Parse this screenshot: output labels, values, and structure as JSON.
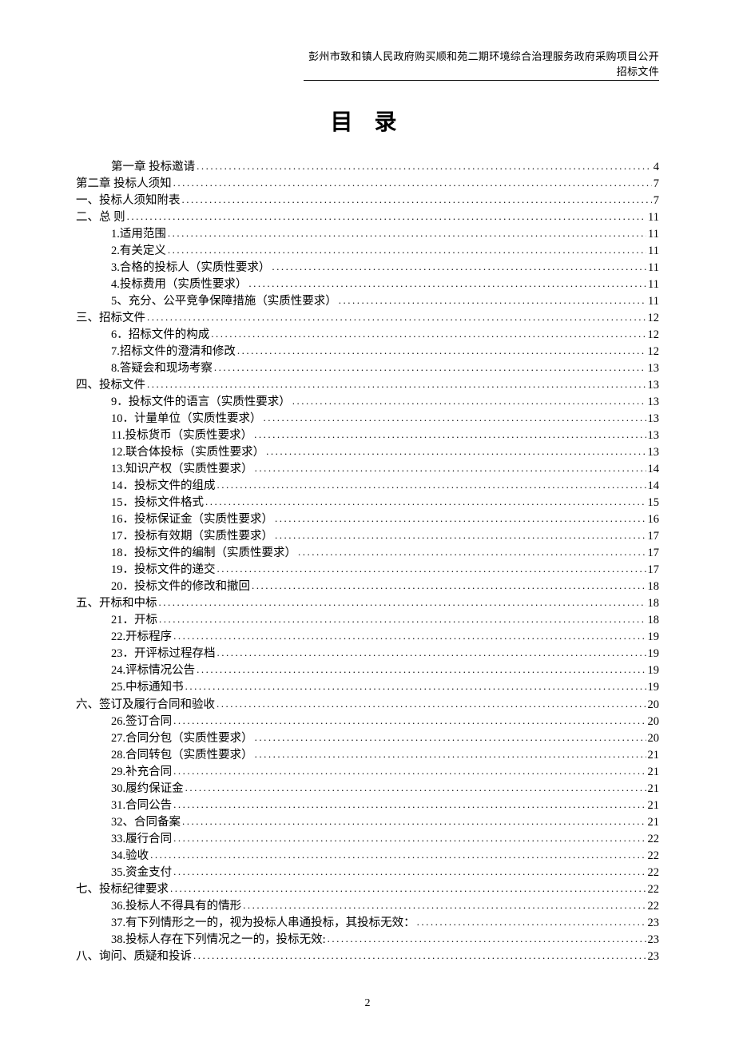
{
  "header": "彭州市致和镇人民政府购买顺和苑二期环境综合治理服务政府采购项目公开招标文件",
  "title": "目  录",
  "page_number": "2",
  "toc": [
    {
      "indent": 0,
      "label": "第一章    投标邀请",
      "page": "4"
    },
    {
      "indent": 1,
      "label": "第二章    投标人须知",
      "page": "7"
    },
    {
      "indent": 1,
      "label": "一、投标人须知附表",
      "page": "7"
    },
    {
      "indent": 1,
      "label": "二、总    则",
      "page": "11"
    },
    {
      "indent": 2,
      "label": "1.适用范围",
      "page": "11"
    },
    {
      "indent": 2,
      "label": "2.有关定义",
      "page": "11"
    },
    {
      "indent": 2,
      "label": "3.合格的投标人（实质性要求）",
      "page": "11"
    },
    {
      "indent": 2,
      "label": "4.投标费用（实质性要求）",
      "page": "11"
    },
    {
      "indent": 2,
      "label": "5、充分、公平竞争保障措施（实质性要求）",
      "page": "11"
    },
    {
      "indent": 1,
      "label": "三、招标文件",
      "page": "12"
    },
    {
      "indent": 2,
      "label": "6．招标文件的构成",
      "page": "12"
    },
    {
      "indent": 2,
      "label": "7.招标文件的澄清和修改",
      "page": "12"
    },
    {
      "indent": 2,
      "label": "8.答疑会和现场考察",
      "page": "13"
    },
    {
      "indent": 1,
      "label": "四、投标文件",
      "page": "13"
    },
    {
      "indent": 2,
      "label": "9．投标文件的语言（实质性要求）",
      "page": "13"
    },
    {
      "indent": 2,
      "label": "10．计量单位（实质性要求）",
      "page": "13"
    },
    {
      "indent": 2,
      "label": "11.投标货币（实质性要求）",
      "page": "13"
    },
    {
      "indent": 2,
      "label": "12.联合体投标（实质性要求）",
      "page": "13"
    },
    {
      "indent": 2,
      "label": "13.知识产权（实质性要求）",
      "page": "14"
    },
    {
      "indent": 2,
      "label": "14．投标文件的组成",
      "page": "14"
    },
    {
      "indent": 2,
      "label": "15．投标文件格式",
      "page": "15"
    },
    {
      "indent": 2,
      "label": "16．投标保证金（实质性要求）",
      "page": "16"
    },
    {
      "indent": 2,
      "label": "17．投标有效期（实质性要求）",
      "page": "17"
    },
    {
      "indent": 2,
      "label": "18．投标文件的编制（实质性要求）",
      "page": "17"
    },
    {
      "indent": 2,
      "label": "19．投标文件的递交",
      "page": "17"
    },
    {
      "indent": 2,
      "label": "20．投标文件的修改和撤回",
      "page": "18"
    },
    {
      "indent": 1,
      "label": "五、开标和中标",
      "page": "18"
    },
    {
      "indent": 2,
      "label": "21．开标",
      "page": "18"
    },
    {
      "indent": 2,
      "label": "22.开标程序",
      "page": "19"
    },
    {
      "indent": 2,
      "label": "23．开评标过程存档",
      "page": "19"
    },
    {
      "indent": 2,
      "label": "24.评标情况公告",
      "page": "19"
    },
    {
      "indent": 2,
      "label": "25.中标通知书",
      "page": "19"
    },
    {
      "indent": 1,
      "label": "六、签订及履行合同和验收",
      "page": "20"
    },
    {
      "indent": 2,
      "label": "26.签订合同",
      "page": "20"
    },
    {
      "indent": 2,
      "label": "27.合同分包（实质性要求）",
      "page": "20"
    },
    {
      "indent": 2,
      "label": "28.合同转包（实质性要求）",
      "page": "21"
    },
    {
      "indent": 2,
      "label": "29.补充合同",
      "page": "21"
    },
    {
      "indent": 2,
      "label": "30.履约保证金",
      "page": "21"
    },
    {
      "indent": 2,
      "label": "31.合同公告",
      "page": "21"
    },
    {
      "indent": 2,
      "label": "32、合同备案",
      "page": "21"
    },
    {
      "indent": 2,
      "label": "33.履行合同",
      "page": "22"
    },
    {
      "indent": 2,
      "label": "34.验收",
      "page": "22"
    },
    {
      "indent": 2,
      "label": "35.资金支付",
      "page": "22"
    },
    {
      "indent": 1,
      "label": "七、投标纪律要求",
      "page": "22"
    },
    {
      "indent": 2,
      "label": "36.投标人不得具有的情形",
      "page": "22"
    },
    {
      "indent": 2,
      "label": "37.有下列情形之一的，视为投标人串通投标，其投标无效：",
      "page": "23"
    },
    {
      "indent": 2,
      "label": "38.投标人存在下列情况之一的，投标无效:",
      "page": "23"
    },
    {
      "indent": 1,
      "label": "八、询问、质疑和投诉",
      "page": "23"
    }
  ]
}
